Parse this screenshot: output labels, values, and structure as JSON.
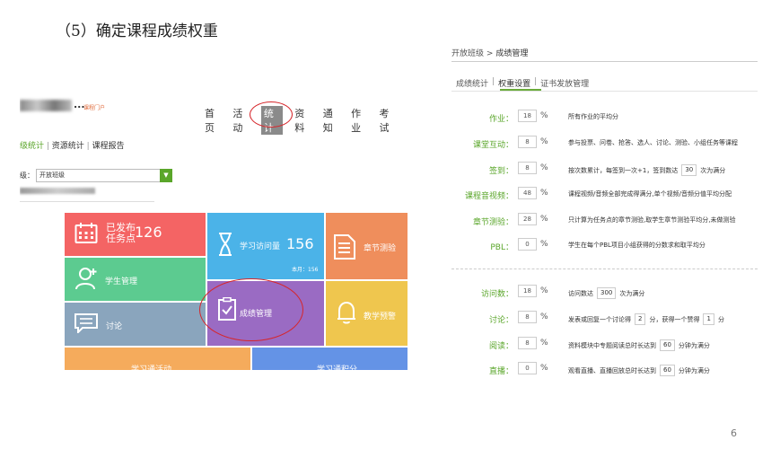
{
  "slide": {
    "title": "（5）确定课程成绩权重",
    "page_number": "6"
  },
  "left": {
    "logo_suffix": "...",
    "portal": "课程门户",
    "nav": [
      "首页",
      "活动",
      "统计",
      "资料",
      "通知",
      "作业",
      "考试"
    ],
    "subnav": {
      "item1": "级统计",
      "item2": "资源统计",
      "item3": "课程报告"
    },
    "class_label": "级：",
    "class_value": "开放班级",
    "tiles": {
      "published_label1": "已发布",
      "published_label2": "任务点",
      "published_count": "126",
      "visits_label": "学习访问量",
      "visits_count": "156",
      "visits_week": "本月：156",
      "chapter_test": "章节测验",
      "student_mgmt": "学生管理",
      "discussion": "讨论",
      "grade_mgmt": "成绩管理",
      "warning": "教学预警",
      "bottom1": "学习通活动",
      "bottom2": "学习通积分"
    }
  },
  "right": {
    "breadcrumb": {
      "parent": "开放班级",
      "sep": ">",
      "current": "成绩管理"
    },
    "tabs": [
      "成绩统计",
      "权重设置",
      "证书发放管理"
    ],
    "rows": [
      {
        "label": "作业：",
        "value": "18",
        "pct": "%",
        "desc": "所有作业的平均分"
      },
      {
        "label": "课堂互动：",
        "value": "8",
        "pct": "%",
        "desc": "参与投票、问卷、抢答、选人、讨论、测验、小组任务等课程"
      },
      {
        "label": "签到：",
        "value": "8",
        "pct": "%",
        "desc_pre": "按次数累计，每签到一次+1，签到数达",
        "input": "30",
        "desc_post": "次为满分"
      },
      {
        "label": "课程音视频：",
        "value": "48",
        "pct": "%",
        "desc": "课程视频/音频全部完成得满分,单个视频/音频分值平均分配"
      },
      {
        "label": "章节测验：",
        "value": "28",
        "pct": "%",
        "desc": "只计算为任务点的章节测验,取学生章节测验平均分,未做测验"
      },
      {
        "label": "PBL：",
        "value": "0",
        "pct": "%",
        "desc": "学生在每个PBL项目小组获得的分数求和取平均分"
      },
      {
        "label": "访问数：",
        "value": "18",
        "pct": "%",
        "desc_pre": "访问数达",
        "input": "300",
        "desc_post": "次为满分"
      },
      {
        "label": "讨论：",
        "value": "8",
        "pct": "%",
        "desc_pre": "发表或回复一个讨论得",
        "input": "2",
        "desc_mid": "分，获得一个赞得",
        "input2": "1",
        "desc_post": "分"
      },
      {
        "label": "阅读：",
        "value": "8",
        "pct": "%",
        "desc_pre": "资料模块中专题阅读总时长达到",
        "input": "60",
        "desc_post": "分钟为满分"
      },
      {
        "label": "直播：",
        "value": "0",
        "pct": "%",
        "desc_pre": "观看直播、直播回放总时长达到",
        "input": "60",
        "desc_post": "分钟为满分"
      }
    ]
  },
  "colors": {
    "green": "#5aa62a",
    "red_ring": "#d6262b",
    "tile_red": "#f46464",
    "tile_blue": "#4bb3e8",
    "tile_orange": "#ef8e5c",
    "tile_green": "#5ccb90",
    "tile_gray": "#8aa5bd",
    "tile_purple": "#9a6bc3",
    "tile_yellow": "#efc64e"
  }
}
